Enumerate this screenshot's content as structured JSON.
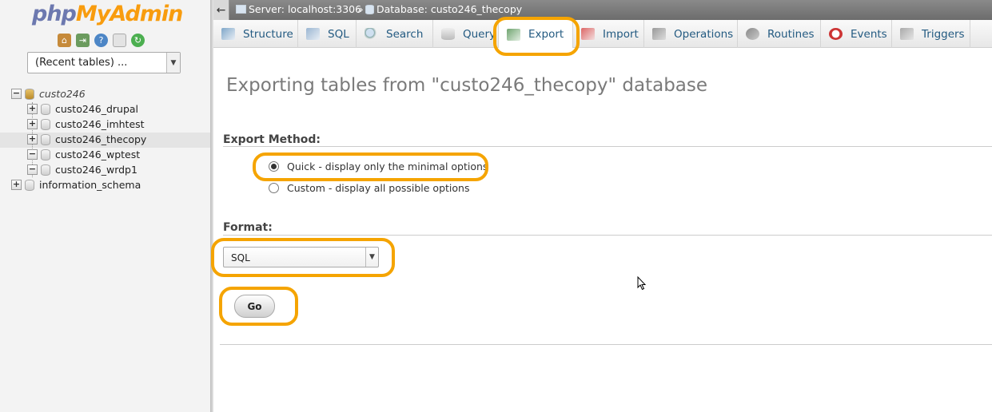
{
  "sidebar": {
    "logo_php": "php",
    "logo_myadmin": "MyAdmin",
    "quick_icons": [
      "home-icon",
      "logout-icon",
      "help-icon",
      "docs-icon",
      "reload-icon"
    ],
    "recent_tables": "(Recent tables) ...",
    "tree": {
      "server_db": "custo246",
      "children": [
        "custo246_drupal",
        "custo246_imhtest",
        "custo246_thecopy",
        "custo246_wptest",
        "custo246_wrdp1"
      ],
      "other_db": "information_schema"
    }
  },
  "topbar": {
    "back": "←",
    "server": "Server: localhost:3306",
    "separator": "»",
    "database": "Database: custo246_thecopy"
  },
  "tabs": [
    {
      "label": "Structure",
      "icon": "structure-icon"
    },
    {
      "label": "SQL",
      "icon": "sql-icon"
    },
    {
      "label": "Search",
      "icon": "search-icon"
    },
    {
      "label": "Query",
      "icon": "query-icon"
    },
    {
      "label": "Export",
      "icon": "export-icon"
    },
    {
      "label": "Import",
      "icon": "import-icon"
    },
    {
      "label": "Operations",
      "icon": "wrench-icon"
    },
    {
      "label": "Routines",
      "icon": "routines-icon"
    },
    {
      "label": "Events",
      "icon": "clock-icon"
    },
    {
      "label": "Triggers",
      "icon": "triggers-icon"
    }
  ],
  "main": {
    "title": "Exporting tables from \"custo246_thecopy\" database",
    "export_method_label": "Export Method:",
    "quick_option": "Quick - display only the minimal options",
    "custom_option": "Custom - display all possible options",
    "format_label": "Format:",
    "format_value": "SQL",
    "go_label": "Go"
  },
  "colors": {
    "highlight": "#f5a400",
    "link": "#235a81",
    "logo_php": "#6c78af",
    "logo_myadmin": "#f89c0e"
  }
}
